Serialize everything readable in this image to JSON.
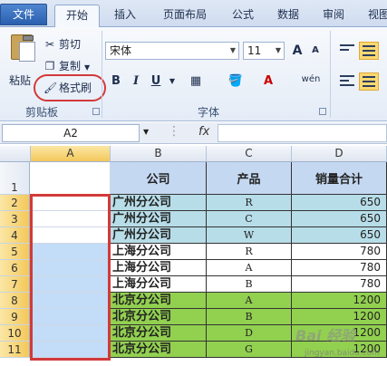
{
  "tabs": [
    "文件",
    "开始",
    "插入",
    "页面布局",
    "公式",
    "数据",
    "审阅",
    "视图"
  ],
  "clipboard": {
    "paste_label": "粘贴",
    "cut_label": "剪切",
    "copy_label": "复制",
    "format_painter_label": "格式刷",
    "group_label": "剪贴板"
  },
  "font": {
    "name": "宋体",
    "size": "11",
    "bold": "B",
    "italic": "I",
    "underline": "U",
    "grow": "A",
    "shrink": "A",
    "font_color": "A",
    "phonetic": "wén",
    "group_label": "字体"
  },
  "formula_bar": {
    "name_box": "A2",
    "fx": "fx",
    "content": ""
  },
  "columns": [
    "A",
    "B",
    "C",
    "D"
  ],
  "rows": [
    "1",
    "2",
    "3",
    "4",
    "5",
    "6",
    "7",
    "8",
    "9",
    "10",
    "11"
  ],
  "table": {
    "headers": [
      "公司",
      "产品",
      "销量合计"
    ],
    "rows": [
      {
        "company": "广州分公司",
        "product": "R",
        "sales": "650"
      },
      {
        "company": "广州分公司",
        "product": "C",
        "sales": "650"
      },
      {
        "company": "广州分公司",
        "product": "W",
        "sales": "650"
      },
      {
        "company": "上海分公司",
        "product": "R",
        "sales": "780"
      },
      {
        "company": "上海分公司",
        "product": "A",
        "sales": "780"
      },
      {
        "company": "上海分公司",
        "product": "B",
        "sales": "780"
      },
      {
        "company": "北京分公司",
        "product": "A",
        "sales": "1200"
      },
      {
        "company": "北京分公司",
        "product": "B",
        "sales": "1200"
      },
      {
        "company": "北京分公司",
        "product": "D",
        "sales": "1200"
      },
      {
        "company": "北京分公司",
        "product": "G",
        "sales": "1200"
      }
    ]
  },
  "watermark": {
    "text": "Bai 经验",
    "url": "jingyan.baidu.com"
  },
  "colors": {
    "header_fill": "#c5d8f1",
    "guangzhou_fill": "#b7dde8",
    "beijing_fill": "#92d050",
    "selection_fill": "#c3dcf7",
    "highlight_outline": "#d23a3a"
  }
}
